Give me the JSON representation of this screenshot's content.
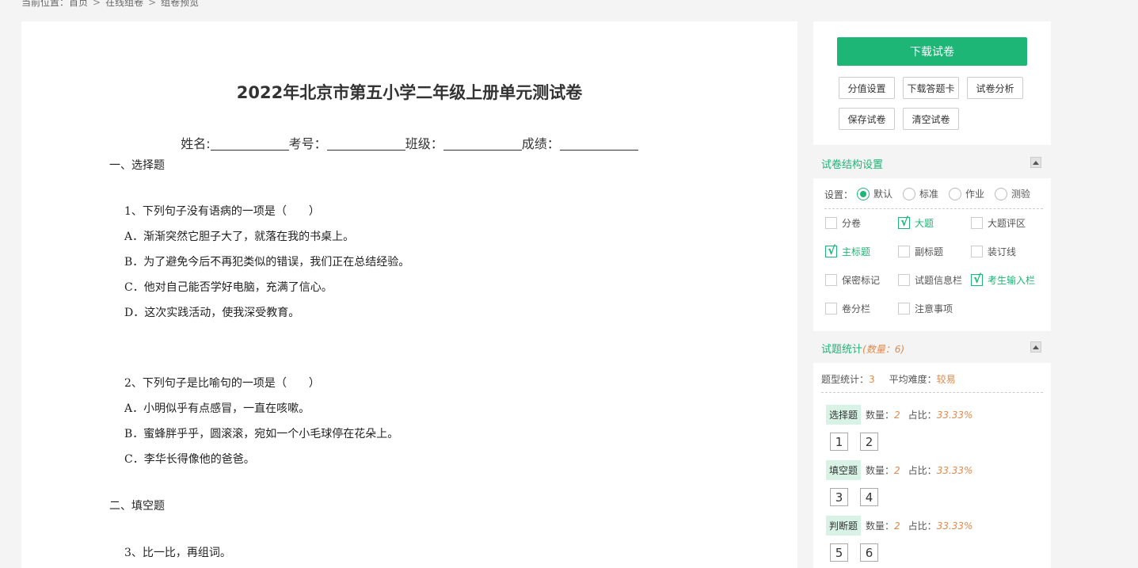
{
  "breadcrumb": {
    "prefix": "当前位置：",
    "items": [
      "首页",
      "在线组卷",
      "组卷预览"
    ],
    "separator": ">"
  },
  "paper": {
    "title": "2022年北京市第五小学二年级上册单元测试卷",
    "info_fields": [
      "姓名:",
      "考号：",
      "班级：",
      "成绩："
    ],
    "sections": [
      {
        "heading": "一、选择题",
        "questions": [
          {
            "stem": "1、下列句子没有语病的一项是（　　）",
            "options": [
              "A．渐渐突然它胆子大了，就落在我的书桌上。",
              "B．为了避免今后不再犯类似的错误，我们正在总结经验。",
              "C．他对自己能否学好电脑，充满了信心。",
              "D．这次实践活动，使我深受教育。"
            ]
          },
          {
            "stem": "2、下列句子是比喻句的一项是（　　）",
            "options": [
              "A．小明似乎有点感冒，一直在咳嗽。",
              "B．蜜蜂胖乎乎，圆滚滚，宛如一个小毛球停在花朵上。",
              "C．李华长得像他的爸爸。"
            ]
          }
        ]
      },
      {
        "heading": "二、填空题",
        "questions": [
          {
            "stem": "3、比一比，再组词。",
            "options": []
          }
        ]
      }
    ]
  },
  "sidebar": {
    "download_label": "下载试卷",
    "buttons": [
      "分值设置",
      "下载答题卡",
      "试卷分析",
      "保存试卷",
      "清空试卷"
    ],
    "structure": {
      "title": "试卷结构设置",
      "settings_label": "设置：",
      "radios": [
        {
          "label": "默认",
          "selected": true
        },
        {
          "label": "标准",
          "selected": false
        },
        {
          "label": "作业",
          "selected": false
        },
        {
          "label": "测验",
          "selected": false
        }
      ],
      "checkboxes": [
        {
          "label": "分卷",
          "checked": false
        },
        {
          "label": "大题",
          "checked": true
        },
        {
          "label": "大题评区",
          "checked": false
        },
        {
          "label": "主标题",
          "checked": true
        },
        {
          "label": "副标题",
          "checked": false
        },
        {
          "label": "装订线",
          "checked": false
        },
        {
          "label": "保密标记",
          "checked": false
        },
        {
          "label": "试题信息栏",
          "checked": false
        },
        {
          "label": "考生输入栏",
          "checked": true
        },
        {
          "label": "卷分栏",
          "checked": false
        },
        {
          "label": "注意事项",
          "checked": false
        }
      ]
    },
    "stats": {
      "title": "试题统计",
      "count_text": "(数量：6)",
      "type_label": "题型统计：",
      "type_count": "3",
      "difficulty_label": "平均难度：",
      "difficulty_value": "较易",
      "count_label": "数量：",
      "ratio_label": "占比：",
      "types": [
        {
          "name": "选择题",
          "count": "2",
          "ratio": "33.33%",
          "nums": [
            "1",
            "2"
          ]
        },
        {
          "name": "填空题",
          "count": "2",
          "ratio": "33.33%",
          "nums": [
            "3",
            "4"
          ]
        },
        {
          "name": "判断题",
          "count": "2",
          "ratio": "33.33%",
          "nums": [
            "5",
            "6"
          ]
        }
      ]
    }
  },
  "colors": {
    "accent": "#1db677",
    "highlight": "#e08a4d",
    "tag_bg": "#d8f3e6"
  }
}
